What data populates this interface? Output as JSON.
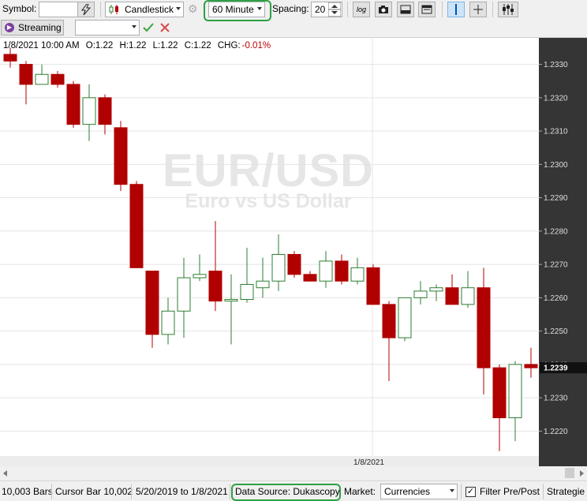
{
  "toolbar": {
    "symbol_label": "Symbol:",
    "symbol_value": "",
    "chart_type": "Candlestick",
    "interval": "60 Minute",
    "spacing_label": "Spacing:",
    "spacing_value": "20",
    "log_button": "log"
  },
  "toolbar2": {
    "streaming_label": "Streaming",
    "combo_value": ""
  },
  "info_bar": {
    "date": "1/8/2021 10:00 AM",
    "open": "O:1.22",
    "high": "H:1.22",
    "low": "L:1.22",
    "close": "C:1.22",
    "chg_label": "CHG:",
    "chg_value": "-0.01%"
  },
  "watermark": {
    "symbol": "EUR/USD",
    "name": "Euro vs US Dollar"
  },
  "x_axis_label": "1/8/2021",
  "colors": {
    "up_outline": "#2e7d32",
    "down_fill": "#b00000",
    "axis_bg": "#353535",
    "highlight": "#2ea043"
  },
  "chart_data": {
    "type": "candlestick",
    "ylim": [
      1.2213,
      1.2337
    ],
    "y_ticks": [
      "1.2330",
      "1.2320",
      "1.2310",
      "1.2300",
      "1.2290",
      "1.2280",
      "1.2270",
      "1.2260",
      "1.2250",
      "1.2240",
      "1.2230",
      "1.2220"
    ],
    "last_price": "1.2239",
    "candles": [
      {
        "o": 1.2333,
        "h": 1.2335,
        "l": 1.2329,
        "c": 1.2331
      },
      {
        "o": 1.233,
        "h": 1.2331,
        "l": 1.2318,
        "c": 1.2324
      },
      {
        "o": 1.2324,
        "h": 1.233,
        "l": 1.2324,
        "c": 1.2327
      },
      {
        "o": 1.2327,
        "h": 1.2328,
        "l": 1.2323,
        "c": 1.2324
      },
      {
        "o": 1.2324,
        "h": 1.2325,
        "l": 1.2311,
        "c": 1.2312
      },
      {
        "o": 1.2312,
        "h": 1.2324,
        "l": 1.2307,
        "c": 1.232
      },
      {
        "o": 1.232,
        "h": 1.2321,
        "l": 1.2309,
        "c": 1.2312
      },
      {
        "o": 1.2311,
        "h": 1.2313,
        "l": 1.2292,
        "c": 1.2294
      },
      {
        "o": 1.2294,
        "h": 1.2295,
        "l": 1.2269,
        "c": 1.2269
      },
      {
        "o": 1.2268,
        "h": 1.2268,
        "l": 1.2245,
        "c": 1.2249
      },
      {
        "o": 1.2249,
        "h": 1.226,
        "l": 1.2246,
        "c": 1.2256
      },
      {
        "o": 1.2256,
        "h": 1.2272,
        "l": 1.2248,
        "c": 1.2266
      },
      {
        "o": 1.2266,
        "h": 1.2273,
        "l": 1.2265,
        "c": 1.2267
      },
      {
        "o": 1.2268,
        "h": 1.2283,
        "l": 1.2256,
        "c": 1.2259
      },
      {
        "o": 1.2259,
        "h": 1.2267,
        "l": 1.2246,
        "c": 1.22595
      },
      {
        "o": 1.22595,
        "h": 1.2275,
        "l": 1.22585,
        "c": 1.2264
      },
      {
        "o": 1.2263,
        "h": 1.2272,
        "l": 1.226,
        "c": 1.2265
      },
      {
        "o": 1.2265,
        "h": 1.2279,
        "l": 1.2262,
        "c": 1.2273
      },
      {
        "o": 1.2273,
        "h": 1.2274,
        "l": 1.2266,
        "c": 1.2267
      },
      {
        "o": 1.2267,
        "h": 1.2268,
        "l": 1.2265,
        "c": 1.2265
      },
      {
        "o": 1.2265,
        "h": 1.2274,
        "l": 1.2263,
        "c": 1.2271
      },
      {
        "o": 1.2271,
        "h": 1.2273,
        "l": 1.2264,
        "c": 1.2265
      },
      {
        "o": 1.2265,
        "h": 1.2272,
        "l": 1.2264,
        "c": 1.2269
      },
      {
        "o": 1.2269,
        "h": 1.227,
        "l": 1.2258,
        "c": 1.2258
      },
      {
        "o": 1.2258,
        "h": 1.2259,
        "l": 1.2235,
        "c": 1.2248
      },
      {
        "o": 1.2248,
        "h": 1.226,
        "l": 1.2247,
        "c": 1.226
      },
      {
        "o": 1.226,
        "h": 1.2265,
        "l": 1.2258,
        "c": 1.2262
      },
      {
        "o": 1.2262,
        "h": 1.2264,
        "l": 1.2259,
        "c": 1.2263
      },
      {
        "o": 1.2263,
        "h": 1.2267,
        "l": 1.2258,
        "c": 1.2258
      },
      {
        "o": 1.2258,
        "h": 1.2268,
        "l": 1.2257,
        "c": 1.2263
      },
      {
        "o": 1.2263,
        "h": 1.2269,
        "l": 1.2231,
        "c": 1.2239
      },
      {
        "o": 1.2239,
        "h": 1.224,
        "l": 1.2214,
        "c": 1.2224
      },
      {
        "o": 1.2224,
        "h": 1.2241,
        "l": 1.2217,
        "c": 1.224
      },
      {
        "o": 1.224,
        "h": 1.2245,
        "l": 1.2236,
        "c": 1.2239
      }
    ]
  },
  "status": {
    "bars": "10,003 Bars",
    "cursor": "Cursor Bar 10,002",
    "range": "5/20/2019 to 1/8/2021",
    "data_source": "Data Source: Dukascopy",
    "market_label": "Market:",
    "market_value": "Currencies",
    "filter_label": "Filter Pre/Post",
    "strategies": "Strategie"
  }
}
